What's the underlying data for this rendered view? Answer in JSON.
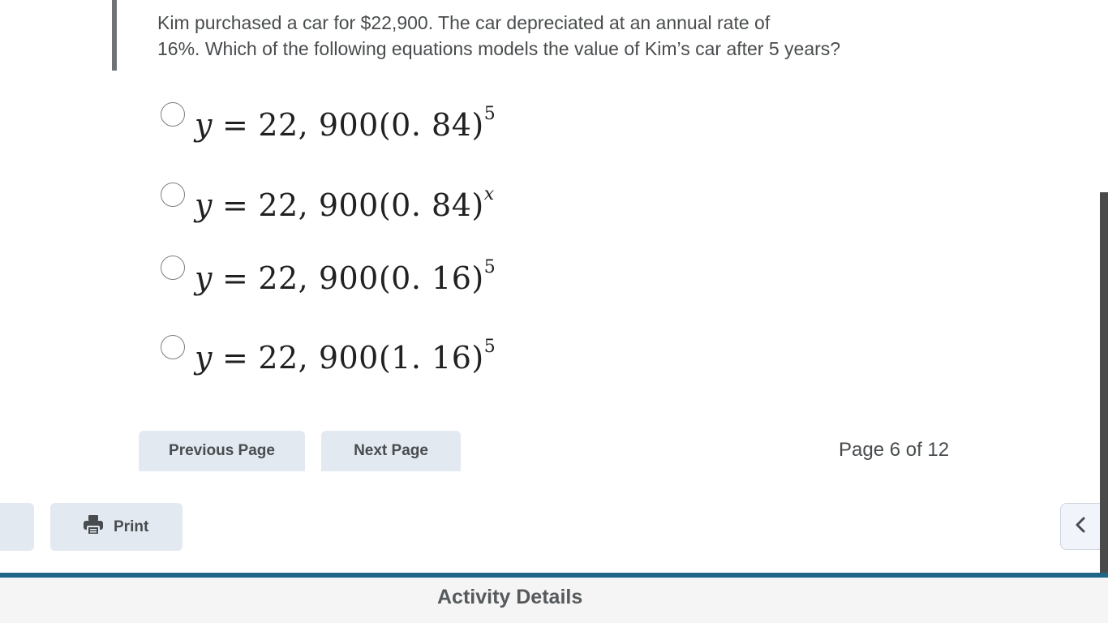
{
  "question": {
    "text": "Kim purchased a car for $22,900.  The car depreciated at an annual rate of\n16%.  Which of the following equations models the value of Kim’s car after 5 years?"
  },
  "options": [
    {
      "lhs": "y",
      "eq": "=",
      "base": "22, 900(0. 84)",
      "exponent": "5"
    },
    {
      "lhs": "y",
      "eq": "=",
      "base": "22, 900(0. 84)",
      "exponent": "x"
    },
    {
      "lhs": "y",
      "eq": "=",
      "base": "22, 900(0. 16)",
      "exponent": "5"
    },
    {
      "lhs": "y",
      "eq": "=",
      "base": "22, 900(1. 16)",
      "exponent": "5"
    }
  ],
  "navigation": {
    "previous_label": "Previous Page",
    "next_label": "Next Page",
    "page_indicator": "Page 6 of 12"
  },
  "toolbar": {
    "print_label": "Print",
    "print_icon": "printer-icon",
    "collapse_icon": "chevron-left-icon"
  },
  "footer": {
    "title": "Activity Details"
  },
  "colors": {
    "button_bg": "#e3e9f1",
    "footer_accent": "#1e6588",
    "text": "#494c4e"
  }
}
